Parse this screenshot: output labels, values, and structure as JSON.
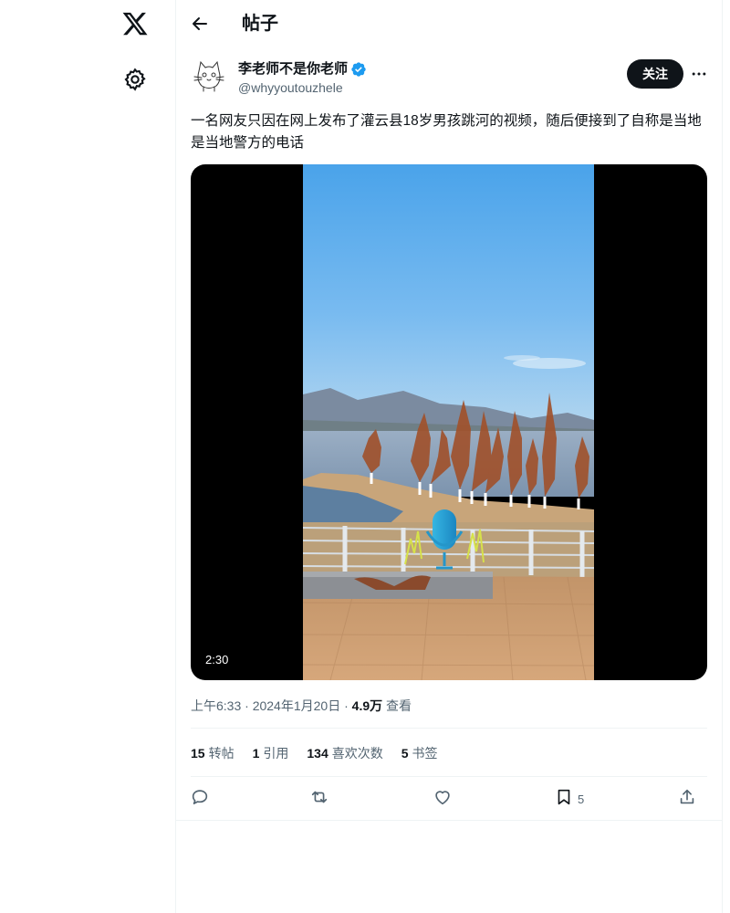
{
  "nav": {
    "logo_icon": "x-logo-icon",
    "settings_icon": "gear-icon"
  },
  "header": {
    "title": "帖子",
    "back_icon": "arrow-left-icon"
  },
  "tweet": {
    "author": {
      "display_name": "李老师不是你老师",
      "handle": "@whyyoutouzhele",
      "verified": true,
      "verified_color": "#1d9bf0"
    },
    "follow_label": "关注",
    "more_icon": "more-horizontal-icon",
    "text": "一名网友只因在网上发布了灌云县18岁男孩跳河的视频，随后便接到了自称是当地是当地警方的电话",
    "video": {
      "duration": "2:30"
    },
    "meta": {
      "time": "上午6:33",
      "date": "2024年1月20日",
      "separator": "·",
      "views_count": "4.9万",
      "views_label": "查看"
    },
    "stats": [
      {
        "count": "15",
        "label": "转帖"
      },
      {
        "count": "1",
        "label": "引用"
      },
      {
        "count": "134",
        "label": "喜欢次数"
      },
      {
        "count": "5",
        "label": "书签"
      }
    ],
    "actions": {
      "reply_icon": "reply-icon",
      "retweet_icon": "retweet-icon",
      "like_icon": "heart-icon",
      "bookmark_icon": "bookmark-icon",
      "bookmark_count": "5",
      "share_icon": "share-icon"
    }
  }
}
